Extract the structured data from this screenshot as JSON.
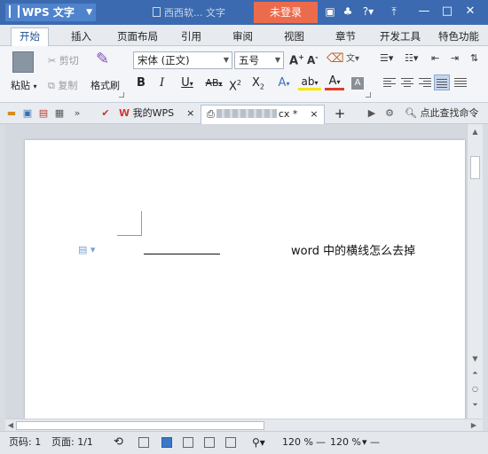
{
  "titlebar": {
    "app_name": "WPS 文字",
    "doc_title": "西西软... 文字",
    "login": "未登录"
  },
  "tabs": [
    "开始",
    "插入",
    "页面布局",
    "引用",
    "审阅",
    "视图",
    "章节",
    "开发工具",
    "特色功能"
  ],
  "ribbon": {
    "paste": "粘贴",
    "cut": "剪切",
    "copy": "复制",
    "format_painter": "格式刷",
    "font_name": "宋体 (正文)",
    "font_size": "五号"
  },
  "doctabs": {
    "my_wps": "我的WPS",
    "active_suffix": "cx *",
    "search_cmd": "点此查找命令"
  },
  "document": {
    "text": "word 中的横线怎么去掉"
  },
  "status": {
    "page_num": "页码: 1",
    "page_count": "页面: 1/1",
    "zoom1": "120 %",
    "zoom2": "120 %"
  }
}
